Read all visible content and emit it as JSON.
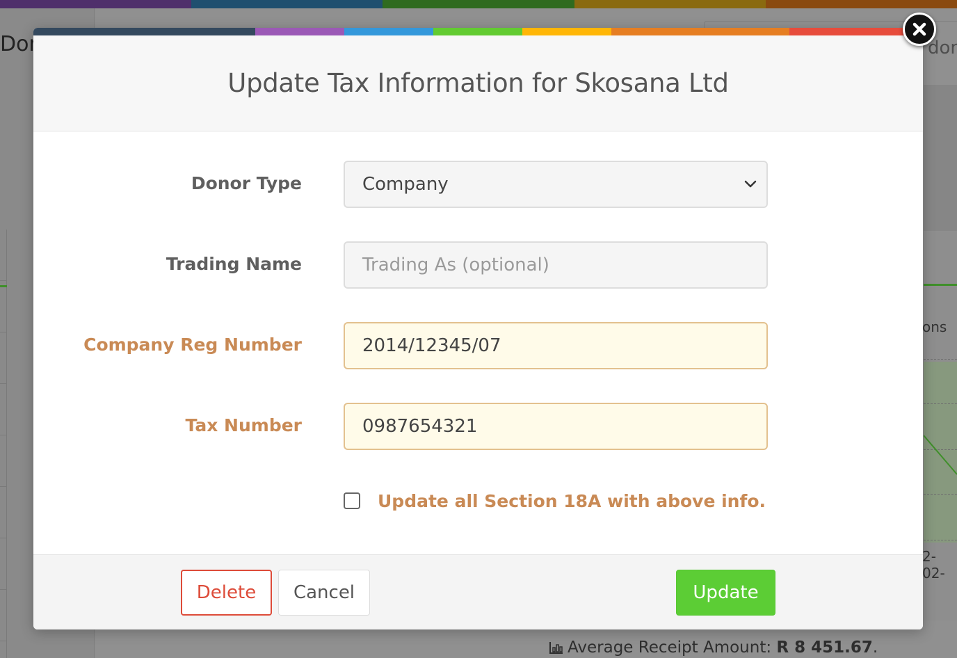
{
  "background": {
    "left_heading": "Don",
    "right_button_text": "don",
    "chart_legend_fragment": "ons",
    "chart_date_fragment": "2-02-",
    "stat_label": "Average Receipt Amount:",
    "stat_value": "R 8 451.67",
    "stat_suffix": ".",
    "topbar_colors": [
      "#4f2f6b",
      "#1f4f6f",
      "#2f6b1f",
      "#8a6a10",
      "#8a4a10"
    ]
  },
  "modal": {
    "title": "Update Tax Information for Skosana Ltd",
    "colorbar": [
      "#34495e",
      "#9b59b6",
      "#3498db",
      "#62cb31",
      "#ffb606",
      "#e67e22",
      "#e74c3c"
    ],
    "fields": {
      "donor_type": {
        "label": "Donor Type",
        "value": "Company"
      },
      "trading_name": {
        "label": "Trading Name",
        "value": "",
        "placeholder": "Trading As (optional)"
      },
      "company_reg_number": {
        "label": "Company Reg Number",
        "value": "2014/12345/07"
      },
      "tax_number": {
        "label": "Tax Number",
        "value": "0987654321"
      }
    },
    "checkbox": {
      "label": "Update all Section 18A with above info.",
      "checked": false
    },
    "buttons": {
      "delete": "Delete",
      "cancel": "Cancel",
      "update": "Update"
    },
    "accent_warning": "#c98a55",
    "accent_success": "#5ccd35",
    "accent_danger": "#dd4b39"
  },
  "icons": {
    "close": "close-icon",
    "select": "chevron-down-icon",
    "stat": "bar-chart-icon"
  }
}
